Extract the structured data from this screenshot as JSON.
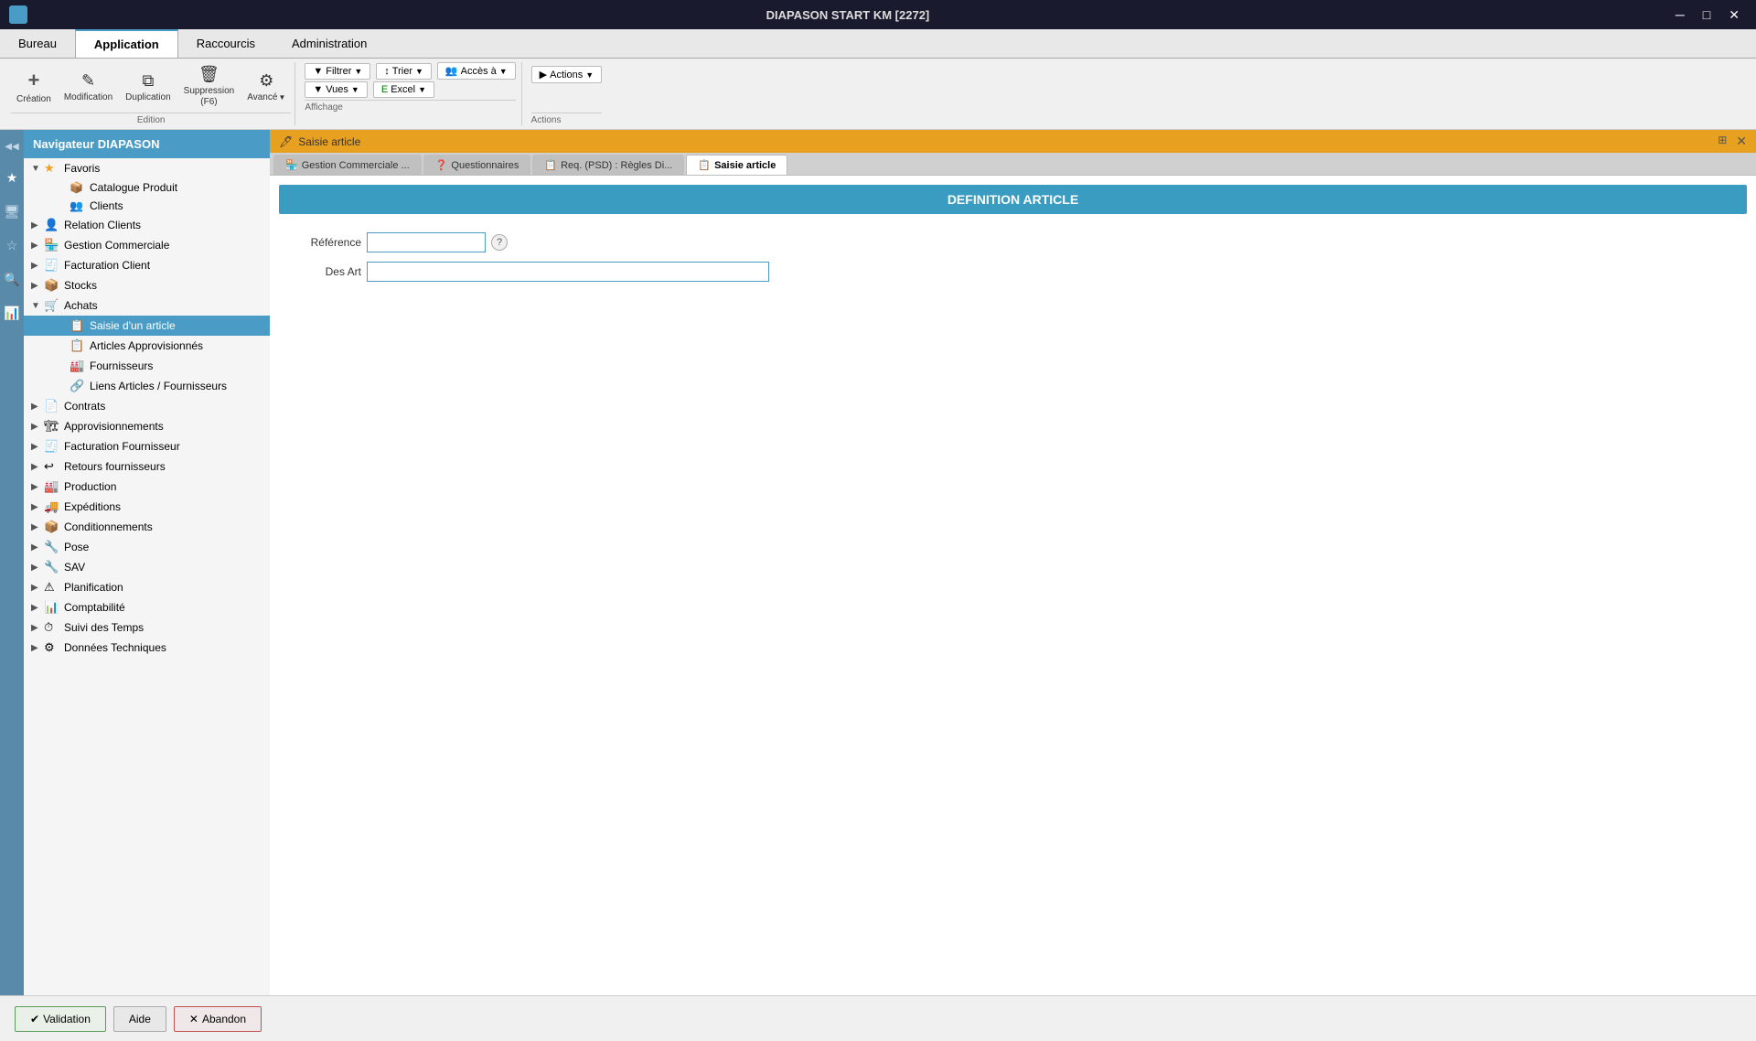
{
  "titlebar": {
    "app_name": "DIAPASON START KM [2272]",
    "minimize": "─",
    "maximize": "□",
    "close": "✕"
  },
  "menubar": {
    "items": [
      {
        "id": "bureau",
        "label": "Bureau",
        "active": false
      },
      {
        "id": "application",
        "label": "Application",
        "active": true
      },
      {
        "id": "raccourcis",
        "label": "Raccourcis",
        "active": false
      },
      {
        "id": "administration",
        "label": "Administration",
        "active": false
      }
    ]
  },
  "toolbar": {
    "edition": {
      "label": "Edition",
      "buttons": [
        {
          "id": "creation",
          "label": "Création",
          "icon": "+"
        },
        {
          "id": "modification",
          "label": "Modification",
          "icon": "✎"
        },
        {
          "id": "duplication",
          "label": "Duplication",
          "icon": "⧉"
        },
        {
          "id": "suppression",
          "label": "Suppression\n(F6)",
          "icon": "🗑"
        },
        {
          "id": "avance",
          "label": "Avancé",
          "icon": "⚙"
        }
      ]
    },
    "affichage": {
      "label": "Affichage",
      "buttons": [
        {
          "id": "filtrer",
          "label": "Filtrer",
          "hasArrow": true
        },
        {
          "id": "trier",
          "label": "Trier",
          "hasArrow": true
        },
        {
          "id": "acces_a",
          "label": "Accès à",
          "hasArrow": true
        },
        {
          "id": "vues",
          "label": "Vues",
          "hasArrow": true
        },
        {
          "id": "excel",
          "label": "Excel",
          "hasArrow": true
        }
      ]
    },
    "actions": {
      "label": "Actions",
      "buttons": [
        {
          "id": "actions",
          "label": "Actions",
          "hasArrow": true
        }
      ]
    }
  },
  "sidebar": {
    "title": "Navigateur DIAPASON",
    "left_icons": [
      {
        "id": "nav-back",
        "icon": "◀",
        "active": false
      },
      {
        "id": "star",
        "icon": "★",
        "active": false
      },
      {
        "id": "monitor",
        "icon": "🖥",
        "active": false
      },
      {
        "id": "star2",
        "icon": "☆",
        "active": false
      },
      {
        "id": "search",
        "icon": "🔍",
        "active": false
      },
      {
        "id": "chart",
        "icon": "📊",
        "active": false
      }
    ],
    "tree": [
      {
        "id": "favoris",
        "label": "Favoris",
        "icon": "★",
        "expanded": true,
        "level": 0,
        "children": [
          {
            "id": "catalogue-produit",
            "label": "Catalogue Produit",
            "icon": "📦",
            "level": 1
          },
          {
            "id": "clients",
            "label": "Clients",
            "icon": "👥",
            "level": 1
          }
        ]
      },
      {
        "id": "relation-clients",
        "label": "Relation Clients",
        "icon": "👤",
        "level": 0,
        "expanded": false
      },
      {
        "id": "gestion-commerciale",
        "label": "Gestion Commerciale",
        "icon": "🏪",
        "level": 0,
        "expanded": false
      },
      {
        "id": "facturation-client",
        "label": "Facturation Client",
        "icon": "🧾",
        "level": 0,
        "expanded": false
      },
      {
        "id": "stocks",
        "label": "Stocks",
        "icon": "📦",
        "level": 0,
        "expanded": false
      },
      {
        "id": "achats",
        "label": "Achats",
        "icon": "🛒",
        "level": 0,
        "expanded": true,
        "children": [
          {
            "id": "saisie-article",
            "label": "Saisie d'un article",
            "icon": "📋",
            "level": 1,
            "active": true
          },
          {
            "id": "articles-appro",
            "label": "Articles Approvisionnés",
            "icon": "📋",
            "level": 1
          },
          {
            "id": "fournisseurs",
            "label": "Fournisseurs",
            "icon": "🏭",
            "level": 1
          },
          {
            "id": "liens-articles",
            "label": "Liens Articles / Fournisseurs",
            "icon": "🔗",
            "level": 1
          }
        ]
      },
      {
        "id": "contrats",
        "label": "Contrats",
        "icon": "📄",
        "level": 0,
        "expanded": false
      },
      {
        "id": "approvisionnements",
        "label": "Approvisionnements",
        "icon": "🏗",
        "level": 0,
        "expanded": false
      },
      {
        "id": "facturation-fourn",
        "label": "Facturation Fournisseur",
        "icon": "🧾",
        "level": 0,
        "expanded": false
      },
      {
        "id": "retours-fourn",
        "label": "Retours fournisseurs",
        "icon": "↩",
        "level": 0,
        "expanded": false
      },
      {
        "id": "production",
        "label": "Production",
        "icon": "🏭",
        "level": 0,
        "expanded": false
      },
      {
        "id": "expeditions",
        "label": "Expéditions",
        "icon": "🚚",
        "level": 0,
        "expanded": false
      },
      {
        "id": "conditionnements",
        "label": "Conditionnements",
        "icon": "📦",
        "level": 0,
        "expanded": false
      },
      {
        "id": "pose",
        "label": "Pose",
        "icon": "🔧",
        "level": 0,
        "expanded": false
      },
      {
        "id": "sav",
        "label": "SAV",
        "icon": "🔧",
        "level": 0,
        "expanded": false
      },
      {
        "id": "planification",
        "label": "Planification",
        "icon": "⚠",
        "level": 0,
        "expanded": false
      },
      {
        "id": "comptabilite",
        "label": "Comptabilité",
        "icon": "📊",
        "level": 0,
        "expanded": false
      },
      {
        "id": "suivi-temps",
        "label": "Suivi des Temps",
        "icon": "⏱",
        "level": 0,
        "expanded": false
      },
      {
        "id": "donnees-tech",
        "label": "Données Techniques",
        "icon": "⚙",
        "level": 0,
        "expanded": false
      }
    ]
  },
  "panel": {
    "title": "Saisie article",
    "icon": "🖊",
    "tabs": [
      {
        "id": "gestion-comm",
        "label": "Gestion Commerciale ...",
        "icon": "🏪"
      },
      {
        "id": "questionnaires",
        "label": "Questionnaires",
        "icon": "❓"
      },
      {
        "id": "req-psd",
        "label": "Req. (PSD) : Règles Di...",
        "icon": "📋"
      },
      {
        "id": "saisie-article",
        "label": "Saisie article",
        "icon": "📋",
        "active": true
      }
    ]
  },
  "form": {
    "title": "DEFINITION ARTICLE",
    "fields": [
      {
        "id": "reference",
        "label": "Référence",
        "value": "",
        "type": "input-medium",
        "has_help": true
      },
      {
        "id": "des-art",
        "label": "Des Art",
        "value": "",
        "type": "input-wide",
        "has_help": false
      }
    ]
  },
  "bottom_buttons": [
    {
      "id": "validation",
      "label": "Validation",
      "icon": "✔",
      "class": "validate"
    },
    {
      "id": "aide",
      "label": "Aide",
      "icon": "",
      "class": "normal"
    },
    {
      "id": "abandon",
      "label": "Abandon",
      "icon": "✕",
      "class": "abandon"
    }
  ]
}
